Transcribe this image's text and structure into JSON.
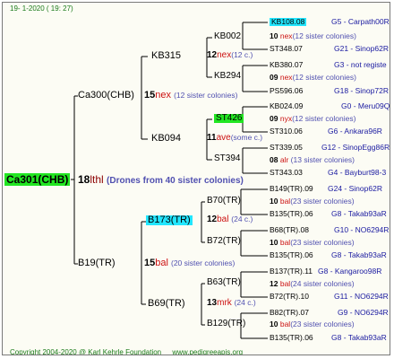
{
  "header": {
    "date": "19-   1-2020 ( 19: 27)"
  },
  "footer": {
    "copyright": "Copyright 2004-2020 @ Karl Kehrle Foundation",
    "site": "www.pedigreeapis.org"
  },
  "root": {
    "name": "Ca301(CHB)",
    "gen": "18",
    "code": "lthl",
    "note": "(Drones from 40 sister colonies)"
  },
  "gen1": [
    {
      "name": "Ca300(CHB)",
      "gen": "15",
      "code": "nex",
      "note": "(12 sister colonies)"
    },
    {
      "name": "B19(TR)",
      "gen": "15",
      "code": "bal",
      "note": "(20 sister colonies)"
    }
  ],
  "gen2": [
    {
      "name": "KB315",
      "gen": "12",
      "code": "nex",
      "note": "(12 c.)"
    },
    {
      "name": "KB094",
      "gen": "11",
      "code": "ave",
      "note": "(some c.)"
    },
    {
      "name": "B173(TR)",
      "gen": "12",
      "code": "bal",
      "note": "(24 c.)"
    },
    {
      "name": "B69(TR)",
      "gen": "13",
      "code": "mrk",
      "note": "(24 c.)"
    }
  ],
  "gen3": [
    {
      "name": "KB002",
      "gen": "10",
      "code": "nex",
      "note": "(12 sister colonies)"
    },
    {
      "name": "KB294",
      "gen": "09",
      "code": "nex",
      "note": "(12 sister colonies)"
    },
    {
      "name": "ST426",
      "gen": "09",
      "code": "nyx",
      "note": "(12 sister colonies)"
    },
    {
      "name": "ST394",
      "gen": "08",
      "code": "alr",
      "note": "(13 sister colonies)"
    },
    {
      "name": "B70(TR)",
      "gen": "10",
      "code": "bal",
      "note": "(23 sister colonies)"
    },
    {
      "name": "B72(TR)",
      "gen": "10",
      "code": "bal",
      "note": "(23 sister colonies)"
    },
    {
      "name": "B63(TR)",
      "gen": "12",
      "code": "bal",
      "note": "(24 sister colonies)"
    },
    {
      "name": "B129(TR)",
      "gen": "10",
      "code": "bal",
      "note": "(23 sister colonies)"
    }
  ],
  "gen4": [
    {
      "left": "KB108.08",
      "right": "G5 - Carpath00R"
    },
    {
      "left": "ST348.07",
      "right": "G21 - Sinop62R"
    },
    {
      "left": "KB380.07",
      "right": "G3 - not registe"
    },
    {
      "left": "PS596.06",
      "right": "G18 - Sinop72R"
    },
    {
      "left": "KB024.09",
      "right": "G0 - Meru09Q"
    },
    {
      "left": "ST310.06",
      "right": "G6 - Ankara96R"
    },
    {
      "left": "ST339.05",
      "right": "G12 - SinopEgg86R"
    },
    {
      "left": "ST343.03",
      "right": "G4 - Bayburt98-3"
    },
    {
      "left": "B149(TR).09",
      "right": "G24 - Sinop62R"
    },
    {
      "left": "B135(TR).06",
      "right": "G8 - Takab93aR"
    },
    {
      "left": "B68(TR).08",
      "right": "G10 - NO6294R"
    },
    {
      "left": "B135(TR).06",
      "right": "G8 - Takab93aR"
    },
    {
      "left": "B137(TR).11",
      "right": "G8 - Kangaroo98R"
    },
    {
      "left": "B72(TR).10",
      "right": "G11 - NO6294R"
    },
    {
      "left": "B82(TR).07",
      "right": "G9 - NO6294R"
    },
    {
      "left": "B135(TR).06",
      "right": "G8 - Takab93aR"
    }
  ]
}
